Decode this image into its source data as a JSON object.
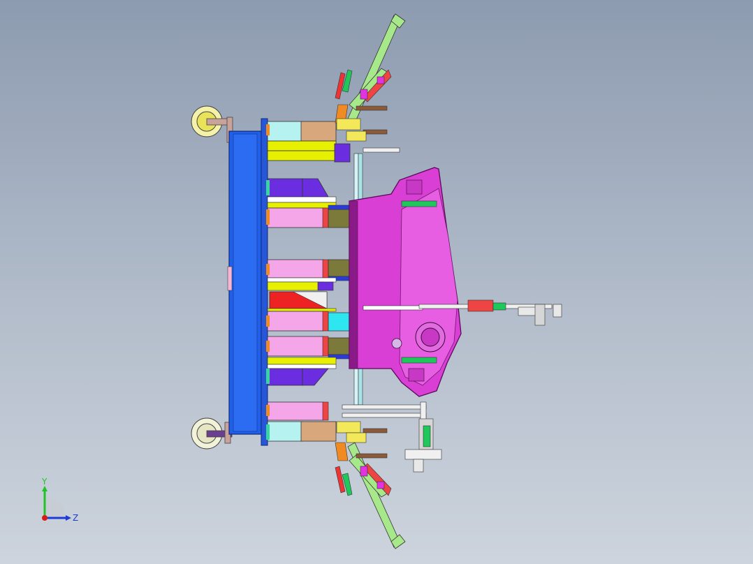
{
  "viewport": {
    "background_top": "#8d9bb0",
    "background_bottom": "#cdd4dd"
  },
  "triad": {
    "y_label": "Y",
    "z_label": "Z",
    "y_color": "#22c32a",
    "z_color": "#1d3bd6",
    "x_color": "#d81b1b"
  },
  "colors": {
    "base_plate": "#1f5fea",
    "magenta_part": "#d93fd4",
    "pink_block": "#f5a6e8",
    "olive_block": "#7c7a3a",
    "cyan_block": "#2ee6f0",
    "yellow_rail": "#e6f000",
    "tan_block": "#d9a77c",
    "violet_block": "#6a2ee0",
    "red_block": "#ee2222",
    "green_arm": "#a7e88a",
    "light_cyan": "#b6f3f0"
  }
}
